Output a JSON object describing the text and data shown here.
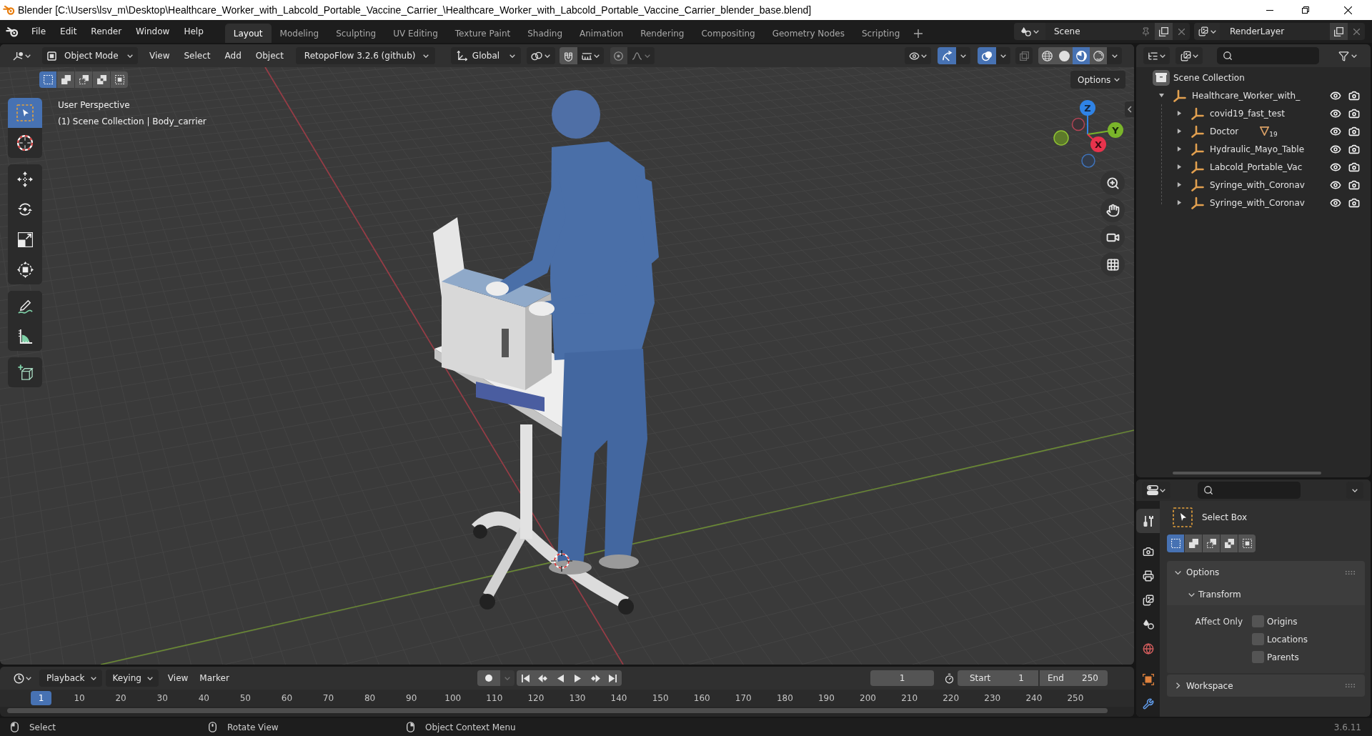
{
  "window": {
    "title": "Blender [C:\\Users\\lsv_m\\Desktop\\Healthcare_Worker_with_Labcold_Portable_Vaccine_Carrier_\\Healthcare_Worker_with_Labcold_Portable_Vaccine_Carrier_blender_base.blend]"
  },
  "menu": [
    "File",
    "Edit",
    "Render",
    "Window",
    "Help"
  ],
  "workspaces": [
    {
      "label": "Layout",
      "selected": true
    },
    {
      "label": "Modeling",
      "selected": false
    },
    {
      "label": "Sculpting",
      "selected": false
    },
    {
      "label": "UV Editing",
      "selected": false
    },
    {
      "label": "Texture Paint",
      "selected": false
    },
    {
      "label": "Shading",
      "selected": false
    },
    {
      "label": "Animation",
      "selected": false
    },
    {
      "label": "Rendering",
      "selected": false
    },
    {
      "label": "Compositing",
      "selected": false
    },
    {
      "label": "Geometry Nodes",
      "selected": false
    },
    {
      "label": "Scripting",
      "selected": false
    }
  ],
  "scene": {
    "name": "Scene"
  },
  "view_layer": {
    "name": "RenderLayer"
  },
  "viewport": {
    "header": {
      "mode": "Object Mode",
      "menus": [
        "View",
        "Select",
        "Add",
        "Object"
      ],
      "addon_menu": "RetopoFlow 3.2.6 (github)",
      "orientation": "Global",
      "snap_on": false,
      "proportional_on": false,
      "gizmos_on": true,
      "overlays_on": true,
      "xray_on": false,
      "shading": [
        {
          "kind": "wireframe",
          "selected": false
        },
        {
          "kind": "solid",
          "selected": false
        },
        {
          "kind": "material",
          "selected": true
        },
        {
          "kind": "rendered",
          "selected": false
        }
      ]
    },
    "select_modes": [
      {
        "kind": "new",
        "selected": true
      },
      {
        "kind": "extend",
        "selected": false
      },
      {
        "kind": "subtract",
        "selected": false
      },
      {
        "kind": "difference",
        "selected": false
      },
      {
        "kind": "intersect",
        "selected": false
      }
    ],
    "options_button": "Options",
    "overlay_text": [
      "User Perspective",
      "(1) Scene Collection | Body_carrier"
    ],
    "toolbar_groups": [
      {
        "tools": [
          {
            "kind": "select_box",
            "selected": true
          },
          {
            "kind": "cursor",
            "selected": false
          }
        ]
      },
      {
        "tools": [
          {
            "kind": "move",
            "selected": false
          },
          {
            "kind": "rotate",
            "selected": false
          },
          {
            "kind": "scale",
            "selected": false
          },
          {
            "kind": "transform",
            "selected": false
          }
        ]
      },
      {
        "tools": [
          {
            "kind": "annotate",
            "selected": false
          },
          {
            "kind": "measure",
            "selected": false
          }
        ]
      },
      {
        "tools": [
          {
            "kind": "add_cube",
            "selected": false
          }
        ]
      }
    ],
    "gizmo_axes": [
      {
        "kind": "z",
        "label": "Z"
      },
      {
        "kind": "y",
        "label": "Y"
      },
      {
        "kind": "x",
        "label": "X"
      }
    ]
  },
  "outliner": {
    "root": "Scene Collection",
    "items": [
      {
        "name": "Healthcare_Worker_with_",
        "expanded": true,
        "visible": true,
        "children": [
          {
            "name": "covid19_fast_test",
            "expanded": false,
            "visible": true
          },
          {
            "name": "Doctor",
            "expanded": false,
            "visible": true,
            "mesh_count": "19"
          },
          {
            "name": "Hydraulic_Mayo_Table",
            "expanded": false,
            "visible": true
          },
          {
            "name": "Labcold_Portable_Vac",
            "expanded": false,
            "visible": true
          },
          {
            "name": "Syringe_with_Coronav",
            "expanded": false,
            "visible": true
          },
          {
            "name": "Syringe_with_Coronav",
            "expanded": false,
            "visible": true
          }
        ]
      }
    ]
  },
  "properties": {
    "tab_groups": [
      {
        "tabs": [
          {
            "kind": "tool",
            "selected": true
          }
        ]
      },
      {
        "tabs": [
          {
            "kind": "render",
            "selected": false
          },
          {
            "kind": "output",
            "selected": false
          },
          {
            "kind": "view_layer",
            "selected": false
          },
          {
            "kind": "scene",
            "selected": false
          },
          {
            "kind": "world",
            "selected": false
          }
        ]
      },
      {
        "tabs": [
          {
            "kind": "object",
            "selected": false
          },
          {
            "kind": "modifiers",
            "selected": false
          }
        ]
      }
    ],
    "tool_name": "Select Box",
    "select_modes": [
      {
        "kind": "new",
        "selected": true
      },
      {
        "kind": "extend",
        "selected": false
      },
      {
        "kind": "subtract",
        "selected": false
      },
      {
        "kind": "difference",
        "selected": false
      },
      {
        "kind": "intersect",
        "selected": false
      }
    ],
    "panels": [
      {
        "title": "Options",
        "expanded": true,
        "subpanels": [
          {
            "title": "Transform",
            "expanded": true,
            "label": "Affect Only",
            "options": [
              {
                "label": "Origins",
                "checked": false
              },
              {
                "label": "Locations",
                "checked": false
              },
              {
                "label": "Parents",
                "checked": false
              }
            ]
          }
        ]
      },
      {
        "title": "Workspace",
        "expanded": false
      }
    ]
  },
  "timeline": {
    "menus": [
      {
        "label": "Playback",
        "dropdown": true
      },
      {
        "label": "Keying",
        "dropdown": true
      },
      {
        "label": "View",
        "dropdown": false
      },
      {
        "label": "Marker",
        "dropdown": false
      }
    ],
    "current_frame": "1",
    "start": {
      "label": "Start",
      "value": "1"
    },
    "end": {
      "label": "End",
      "value": "250"
    },
    "playhead": "1",
    "ruler": [
      "10",
      "20",
      "30",
      "40",
      "50",
      "60",
      "70",
      "80",
      "90",
      "100",
      "110",
      "120",
      "130",
      "140",
      "150",
      "160",
      "170",
      "180",
      "190",
      "200",
      "210",
      "220",
      "230",
      "240",
      "250"
    ]
  },
  "status_bar": {
    "hints": [
      {
        "kind": "left",
        "label": "Select"
      },
      {
        "kind": "middle",
        "label": "Rotate View"
      },
      {
        "kind": "right",
        "label": "Object Context Menu"
      }
    ],
    "version": "3.6.11"
  }
}
